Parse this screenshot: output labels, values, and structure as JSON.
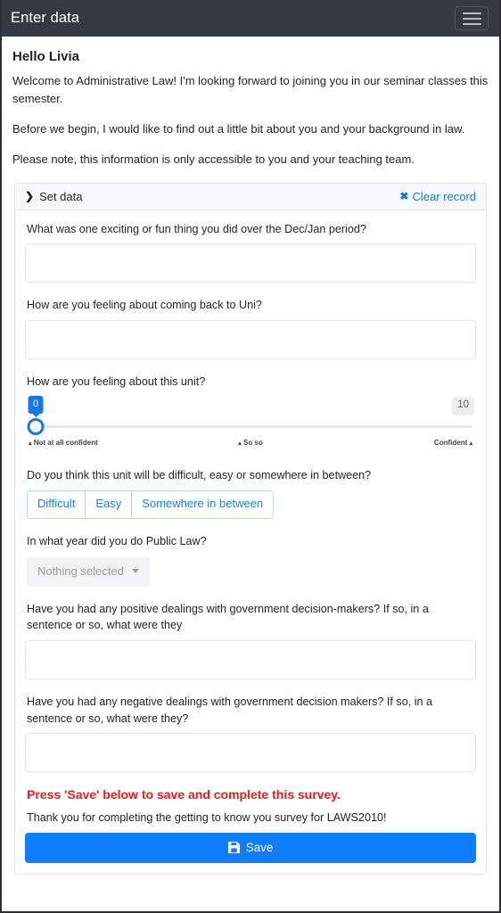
{
  "header": {
    "title": "Enter data",
    "menu_icon": "hamburger-menu-icon"
  },
  "intro": {
    "greeting": "Hello Livia",
    "paragraph_1": "Welcome to Administrative Law! I'm looking forward to joining you in our seminar classes this semester.",
    "paragraph_2": "Before we begin, I would like to find out a little bit about you and your background in law.",
    "paragraph_3": "Please note, this information is only accessible to you and your teaching team."
  },
  "card": {
    "header": {
      "expand_icon": "chevron-right-icon",
      "set_data_label": "Set data",
      "clear_icon": "close-x-icon",
      "clear_record_label": "Clear record"
    }
  },
  "fields": {
    "q1": {
      "label": "What was one exciting or fun thing you did over the Dec/Jan period?",
      "value": "",
      "placeholder": ""
    },
    "q2": {
      "label": "How are you feeling about coming back to Uni?",
      "value": "",
      "placeholder": ""
    },
    "q3": {
      "label": "How are you feeling about this unit?",
      "slider": {
        "value": "0",
        "min": "0",
        "max": "10",
        "tick_left": "Not at all confident",
        "tick_mid": "So so",
        "tick_right": "Confident",
        "caret_glyph": "▴"
      }
    },
    "q4": {
      "label": "Do you think this unit will be difficult, easy or somewhere in between?",
      "options": [
        {
          "label": "Difficult"
        },
        {
          "label": "Easy"
        },
        {
          "label": "Somewhere in between"
        }
      ]
    },
    "q5": {
      "label": "In what year did you do Public Law?",
      "dropdown_value": "Nothing selected"
    },
    "q6": {
      "label": "Have you had any positive dealings with government decision-makers? If so, in a sentence or so, what were they",
      "value": "",
      "placeholder": ""
    },
    "q7": {
      "label": "Have you had any negative dealings with government decision makers? If so, in a sentence or so, what were they?",
      "value": "",
      "placeholder": ""
    }
  },
  "footer": {
    "alert": "Press 'Save' below to save and complete this survey.",
    "thanks": "Thank you for completing the getting to know you survey for LAWS2010!",
    "save_label": "Save",
    "save_icon": "floppy-disk-save-icon"
  },
  "colors": {
    "header_bg": "#343a40",
    "primary": "#0d7efd",
    "link": "#147bd1",
    "alert_red": "#ef1b1b",
    "slider_blue": "#1578e3"
  }
}
